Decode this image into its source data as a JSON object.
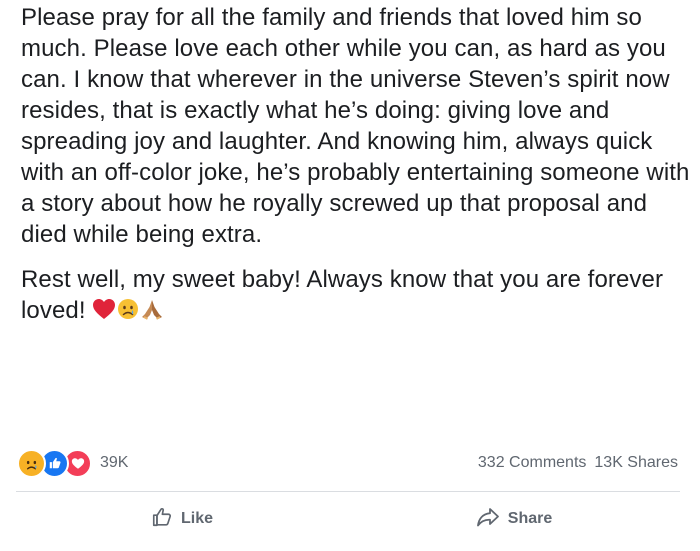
{
  "post": {
    "paragraphs": [
      "Please pray for all the family and friends that loved him so much. Please love each other while you can, as hard as you can. I know that wherever in the universe Steven’s spirit now resides, that is exactly what he’s doing: giving love and spreading joy and laughter. And knowing him, always quick with an off-color joke, he’s probably entertaining someone with a story about how he royally screwed up that proposal and died while being extra.",
      "Rest well, my sweet baby! Always know that you are forever loved!"
    ],
    "inline_emojis": [
      "red-heart",
      "sad-face",
      "folded-hands"
    ]
  },
  "reactions": {
    "icons": [
      "sad-reaction-icon",
      "like-reaction-icon",
      "love-reaction-icon"
    ],
    "count": "39K",
    "comments": "332 Comments",
    "shares": "13K Shares"
  },
  "actions": {
    "like_label": "Like",
    "share_label": "Share"
  },
  "colors": {
    "text": "#1c1e21",
    "muted": "#606770",
    "like_blue": "#1877f2",
    "love_red": "#f33e58",
    "sad_yellow": "#f7b125",
    "divider": "#dadde1"
  }
}
